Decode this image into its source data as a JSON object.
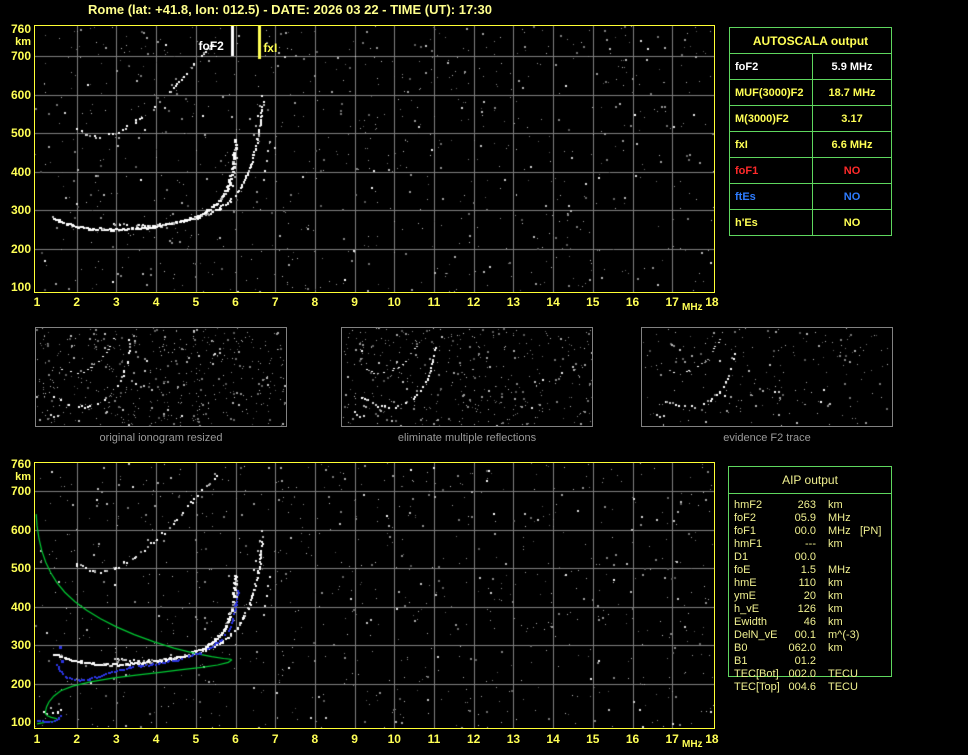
{
  "title": "Rome (lat: +41.8, lon: 012.5) - DATE: 2026 03 22 - TIME (UT): 17:30",
  "colors": {
    "title": "#FFFF8C",
    "axis": "#FFFF55",
    "plot_border": "#FFFF33",
    "grid": "#7F7F7F",
    "table_border": "#5ED65E",
    "white": "#FFFFFF",
    "yellow": "#FFFF55",
    "red": "#FF2A2A",
    "blue": "#2E7CFF",
    "aip_text": "#F0F090",
    "profile_green": "#00CC33",
    "fit_blue": "#2B35E0",
    "caption": "#9A9A9A",
    "panel_border": "#828282"
  },
  "autoscala_table": {
    "title": "AUTOSCALA output",
    "rows": [
      {
        "label": "foF2",
        "value": "5.9 MHz",
        "color_key": "white"
      },
      {
        "label": "MUF(3000)F2",
        "value": "18.7 MHz",
        "color_key": "yellow"
      },
      {
        "label": "M(3000)F2",
        "value": "3.17",
        "color_key": "yellow"
      },
      {
        "label": "fxI",
        "value": "6.6 MHz",
        "color_key": "yellow"
      },
      {
        "label": "foF1",
        "value": "NO",
        "color_key": "red"
      },
      {
        "label": "ftEs",
        "value": "NO",
        "color_key": "blue"
      },
      {
        "label": "h'Es",
        "value": "NO",
        "color_key": "yellow"
      }
    ]
  },
  "aip_table": {
    "title": "AIP output",
    "rows": [
      {
        "label": "hmF2",
        "value": "263",
        "unit": "km",
        "extra": ""
      },
      {
        "label": "foF2",
        "value": "05.9",
        "unit": "MHz",
        "extra": ""
      },
      {
        "label": "foF1",
        "value": "00.0",
        "unit": "MHz",
        "extra": "[PN]"
      },
      {
        "label": "hmF1",
        "value": "---",
        "unit": "km",
        "extra": ""
      },
      {
        "label": "D1",
        "value": "00.0",
        "unit": "",
        "extra": ""
      },
      {
        "label": "foE",
        "value": "1.5",
        "unit": "MHz",
        "extra": ""
      },
      {
        "label": "hmE",
        "value": "110",
        "unit": "km",
        "extra": ""
      },
      {
        "label": "ymE",
        "value": "20",
        "unit": "km",
        "extra": ""
      },
      {
        "label": "h_vE",
        "value": "126",
        "unit": "km",
        "extra": ""
      },
      {
        "label": "Ewidth",
        "value": "46",
        "unit": "km",
        "extra": ""
      },
      {
        "label": "DelN_vE",
        "value": "00.1",
        "unit": "m^(-3)",
        "extra": ""
      },
      {
        "label": "B0",
        "value": "062.0",
        "unit": "km",
        "extra": ""
      },
      {
        "label": "B1",
        "value": "01.2",
        "unit": "",
        "extra": ""
      },
      {
        "label": "TEC[Bot]",
        "value": "002.0",
        "unit": "TECU",
        "extra": ""
      },
      {
        "label": "TEC[Top]",
        "value": "004.6",
        "unit": "TECU",
        "extra": ""
      }
    ]
  },
  "panels": [
    {
      "caption": "original ionogram resized",
      "noise_count": 520,
      "trace_density": 0.62,
      "white_prob": 0.85
    },
    {
      "caption": "eliminate multiple reflections",
      "noise_count": 430,
      "trace_density": 0.55,
      "white_prob": 0.8
    },
    {
      "caption": "evidence F2 trace",
      "noise_count": 210,
      "trace_density": 0.48,
      "white_prob": 0.6
    }
  ],
  "panel_trace": {
    "lower": [
      [
        18,
        68
      ],
      [
        24,
        72
      ],
      [
        32,
        76
      ],
      [
        42,
        78
      ],
      [
        52,
        78
      ],
      [
        62,
        75
      ],
      [
        70,
        70
      ],
      [
        77,
        63
      ],
      [
        83,
        54
      ],
      [
        87,
        44
      ],
      [
        90,
        33
      ],
      [
        92,
        22
      ],
      [
        93,
        12
      ]
    ],
    "upper": [
      [
        24,
        41
      ],
      [
        31,
        44
      ],
      [
        39,
        45
      ],
      [
        47,
        43
      ],
      [
        55,
        39
      ],
      [
        62,
        33
      ],
      [
        68,
        26
      ],
      [
        73,
        18
      ],
      [
        77,
        11
      ]
    ],
    "e_spots": [
      [
        14,
        86
      ],
      [
        17,
        88
      ],
      [
        21,
        87
      ]
    ]
  },
  "chart_data": [
    {
      "type": "scatter",
      "name": "scaled ionogram with AUTOSCALA markers",
      "xlabel": "MHz",
      "ylabel": "km",
      "xlim": [
        1,
        18
      ],
      "ylim": [
        100,
        760
      ],
      "grid": true,
      "xticks": [
        1,
        2,
        3,
        4,
        5,
        6,
        7,
        8,
        9,
        10,
        11,
        12,
        13,
        14,
        15,
        16,
        17,
        18
      ],
      "yticks": [
        760,
        700,
        600,
        500,
        400,
        300,
        200,
        100
      ],
      "markers": [
        {
          "label": "foF2",
          "mhz": 5.9,
          "color_key": "white"
        },
        {
          "label": "fxI",
          "mhz": 6.6,
          "color_key": "yellow"
        }
      ],
      "traces": {
        "f2_ordinary": [
          [
            1.4,
            278
          ],
          [
            1.6,
            272
          ],
          [
            1.8,
            263
          ],
          [
            2.0,
            258
          ],
          [
            2.3,
            254
          ],
          [
            2.6,
            252
          ],
          [
            2.9,
            251
          ],
          [
            3.2,
            252
          ],
          [
            3.5,
            254
          ],
          [
            3.8,
            257
          ],
          [
            4.1,
            261
          ],
          [
            4.4,
            267
          ],
          [
            4.7,
            275
          ],
          [
            5.0,
            286
          ],
          [
            5.2,
            296
          ],
          [
            5.4,
            309
          ],
          [
            5.55,
            324
          ],
          [
            5.7,
            344
          ],
          [
            5.8,
            367
          ],
          [
            5.88,
            395
          ],
          [
            5.93,
            428
          ],
          [
            5.96,
            458
          ],
          [
            5.98,
            483
          ]
        ],
        "f2_extraordinary": [
          [
            2.9,
            267
          ],
          [
            3.2,
            263
          ],
          [
            3.5,
            261
          ],
          [
            3.8,
            261
          ],
          [
            4.1,
            263
          ],
          [
            4.4,
            267
          ],
          [
            4.7,
            273
          ],
          [
            5.0,
            281
          ],
          [
            5.3,
            292
          ],
          [
            5.6,
            307
          ],
          [
            5.85,
            326
          ],
          [
            6.05,
            349
          ],
          [
            6.2,
            376
          ],
          [
            6.35,
            409
          ],
          [
            6.45,
            447
          ],
          [
            6.55,
            489
          ],
          [
            6.62,
            538
          ],
          [
            6.67,
            582
          ]
        ],
        "second_hop": [
          [
            1.96,
            515
          ],
          [
            2.2,
            500
          ],
          [
            2.45,
            492
          ],
          [
            2.7,
            493
          ],
          [
            2.95,
            502
          ],
          [
            3.2,
            515
          ],
          [
            3.45,
            531
          ],
          [
            3.7,
            550
          ],
          [
            3.95,
            571
          ],
          [
            4.2,
            595
          ],
          [
            4.45,
            621
          ],
          [
            4.7,
            649
          ],
          [
            4.9,
            675
          ],
          [
            5.1,
            700
          ],
          [
            5.3,
            721
          ],
          [
            5.5,
            741
          ]
        ],
        "asymptote_dots": [
          [
            5.92,
            365
          ],
          [
            5.95,
            388
          ],
          [
            5.97,
            412
          ],
          [
            6.0,
            438
          ],
          [
            6.02,
            462
          ],
          [
            6.45,
            497
          ],
          [
            6.5,
            521
          ],
          [
            6.55,
            548
          ],
          [
            6.6,
            574
          ],
          [
            6.64,
            599
          ],
          [
            6.7,
            380
          ],
          [
            6.73,
            404
          ],
          [
            6.77,
            430
          ],
          [
            6.8,
            455
          ],
          [
            6.84,
            478
          ]
        ]
      },
      "noise": {
        "seed": 1337,
        "count": 850,
        "bright_count": 45
      }
    },
    {
      "type": "scatter",
      "name": "ionogram with AIP electron density profile and fitted trace",
      "xlabel": "MHz",
      "ylabel": "km",
      "xlim": [
        1,
        18
      ],
      "ylim": [
        100,
        760
      ],
      "grid": true,
      "xticks": [
        1,
        2,
        3,
        4,
        5,
        6,
        7,
        8,
        9,
        10,
        11,
        12,
        13,
        14,
        15,
        16,
        17,
        18
      ],
      "yticks": [
        760,
        700,
        600,
        500,
        400,
        300,
        200,
        100
      ],
      "traces": {
        "f2_ordinary": [
          [
            1.4,
            278
          ],
          [
            1.6,
            272
          ],
          [
            1.8,
            263
          ],
          [
            2.0,
            258
          ],
          [
            2.3,
            254
          ],
          [
            2.6,
            252
          ],
          [
            2.9,
            251
          ],
          [
            3.2,
            252
          ],
          [
            3.5,
            254
          ],
          [
            3.8,
            257
          ],
          [
            4.1,
            261
          ],
          [
            4.4,
            267
          ],
          [
            4.7,
            275
          ],
          [
            5.0,
            286
          ],
          [
            5.2,
            296
          ],
          [
            5.4,
            309
          ],
          [
            5.55,
            324
          ],
          [
            5.7,
            344
          ],
          [
            5.8,
            367
          ],
          [
            5.88,
            395
          ],
          [
            5.93,
            428
          ],
          [
            5.96,
            458
          ],
          [
            5.98,
            483
          ]
        ],
        "f2_extraordinary": [
          [
            2.9,
            267
          ],
          [
            3.2,
            263
          ],
          [
            3.5,
            261
          ],
          [
            3.8,
            261
          ],
          [
            4.1,
            263
          ],
          [
            4.4,
            267
          ],
          [
            4.7,
            273
          ],
          [
            5.0,
            281
          ],
          [
            5.3,
            292
          ],
          [
            5.6,
            307
          ],
          [
            5.85,
            326
          ],
          [
            6.05,
            349
          ],
          [
            6.2,
            376
          ],
          [
            6.35,
            409
          ],
          [
            6.45,
            447
          ],
          [
            6.55,
            489
          ],
          [
            6.62,
            538
          ],
          [
            6.67,
            582
          ]
        ],
        "second_hop": [
          [
            1.96,
            515
          ],
          [
            2.2,
            500
          ],
          [
            2.45,
            492
          ],
          [
            2.7,
            493
          ],
          [
            2.95,
            502
          ],
          [
            3.2,
            515
          ],
          [
            3.45,
            531
          ],
          [
            3.7,
            550
          ],
          [
            3.95,
            571
          ],
          [
            4.2,
            595
          ],
          [
            4.45,
            621
          ],
          [
            4.7,
            649
          ],
          [
            4.9,
            675
          ],
          [
            5.1,
            700
          ],
          [
            5.3,
            721
          ],
          [
            5.5,
            741
          ]
        ],
        "asymptote_dots": [
          [
            5.92,
            365
          ],
          [
            5.95,
            388
          ],
          [
            5.97,
            412
          ],
          [
            6.0,
            438
          ],
          [
            6.02,
            462
          ],
          [
            6.45,
            497
          ],
          [
            6.5,
            521
          ],
          [
            6.55,
            548
          ],
          [
            6.6,
            574
          ],
          [
            6.64,
            599
          ],
          [
            6.7,
            380
          ],
          [
            6.73,
            404
          ],
          [
            6.77,
            430
          ],
          [
            6.8,
            455
          ],
          [
            6.84,
            478
          ]
        ],
        "e_region_echo": [
          [
            1.05,
            131
          ],
          [
            1.2,
            127
          ],
          [
            1.35,
            125
          ],
          [
            1.5,
            128
          ],
          [
            1.6,
            133
          ]
        ]
      },
      "profile_green": [
        [
          0.98,
          640
        ],
        [
          1.0,
          610
        ],
        [
          1.05,
          576
        ],
        [
          1.12,
          545
        ],
        [
          1.22,
          515
        ],
        [
          1.35,
          487
        ],
        [
          1.5,
          462
        ],
        [
          1.7,
          437
        ],
        [
          1.95,
          413
        ],
        [
          2.25,
          390
        ],
        [
          2.6,
          368
        ],
        [
          3.0,
          347
        ],
        [
          3.45,
          327
        ],
        [
          3.95,
          308
        ],
        [
          4.45,
          292
        ],
        [
          4.95,
          279
        ],
        [
          5.4,
          270
        ],
        [
          5.7,
          265
        ],
        [
          5.88,
          263
        ],
        [
          5.9,
          261
        ],
        [
          5.82,
          255
        ],
        [
          5.55,
          248
        ],
        [
          5.15,
          242
        ],
        [
          4.65,
          236
        ],
        [
          4.1,
          229
        ],
        [
          3.5,
          222
        ],
        [
          2.9,
          214
        ],
        [
          2.35,
          204
        ],
        [
          1.9,
          193
        ],
        [
          1.6,
          181
        ],
        [
          1.42,
          167
        ],
        [
          1.3,
          152
        ],
        [
          1.24,
          139
        ],
        [
          1.22,
          130
        ],
        [
          1.21,
          122
        ],
        [
          1.26,
          116
        ],
        [
          1.36,
          112
        ],
        [
          1.48,
          109
        ],
        [
          1.52,
          106
        ],
        [
          1.42,
          102
        ],
        [
          1.27,
          100
        ],
        [
          1.1,
          97
        ],
        [
          1.0,
          95
        ]
      ],
      "fitted_trace_blue": [
        [
          1.5,
          250
        ],
        [
          1.55,
          238
        ],
        [
          1.62,
          228
        ],
        [
          1.72,
          219
        ],
        [
          1.85,
          213
        ],
        [
          2.05,
          211
        ],
        [
          2.3,
          214
        ],
        [
          2.55,
          221
        ],
        [
          2.8,
          229
        ],
        [
          3.05,
          237
        ],
        [
          3.3,
          243
        ],
        [
          3.6,
          248
        ],
        [
          3.9,
          252
        ],
        [
          4.2,
          257
        ],
        [
          4.5,
          263
        ],
        [
          4.8,
          271
        ],
        [
          5.1,
          281
        ],
        [
          5.35,
          294
        ],
        [
          5.6,
          312
        ],
        [
          5.8,
          338
        ],
        [
          5.92,
          370
        ],
        [
          6.0,
          408
        ],
        [
          6.05,
          445
        ]
      ],
      "fitted_e_blue": [
        [
          1.0,
          107
        ],
        [
          1.12,
          104
        ],
        [
          1.28,
          103
        ],
        [
          1.42,
          106
        ],
        [
          1.52,
          111
        ],
        [
          1.58,
          117
        ]
      ],
      "isolated_blue": [
        [
          1.55,
          298
        ],
        [
          1.6,
          260
        ]
      ],
      "noise": {
        "seed": 4242,
        "count": 850,
        "bright_count": 45
      }
    }
  ]
}
